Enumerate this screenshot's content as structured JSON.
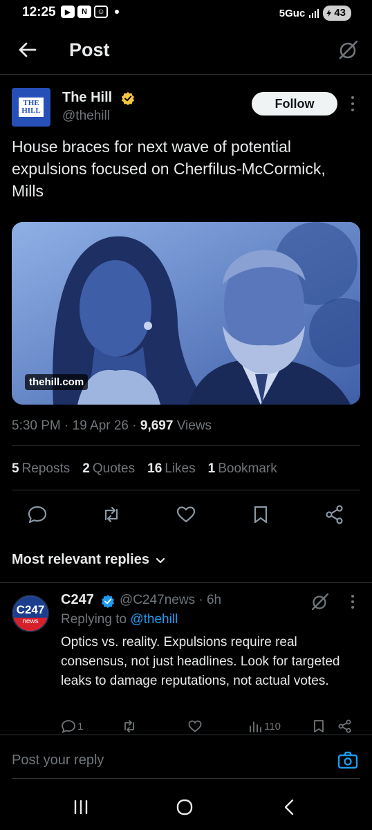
{
  "status_bar": {
    "time": "12:25",
    "network": "5Guc",
    "battery": "43"
  },
  "header": {
    "title": "Post",
    "back_icon": "arrow-left-icon",
    "grok_icon": "grok-icon"
  },
  "tweet": {
    "author_name": "The Hill",
    "author_handle": "@thehill",
    "avatar_text_line1": "THE",
    "avatar_text_line2": "HILL",
    "follow_label": "Follow",
    "text": "House braces for next wave of potential expulsions focused on Cherfilus-McCormick, Mills",
    "media_domain": "thehill.com",
    "time": "5:30 PM",
    "date": "19 Apr 26",
    "views_count": "9,697",
    "views_label": "Views"
  },
  "stats": {
    "reposts_count": "5",
    "reposts_label": "Reposts",
    "quotes_count": "2",
    "quotes_label": "Quotes",
    "likes_count": "16",
    "likes_label": "Likes",
    "bookmarks_count": "1",
    "bookmarks_label": "Bookmark"
  },
  "actions": [
    "reply-icon",
    "repost-icon",
    "like-icon",
    "bookmark-icon",
    "share-icon"
  ],
  "replies": {
    "sort_label": "Most relevant replies"
  },
  "reply": {
    "avatar_top": "C247",
    "avatar_bottom": "news",
    "name": "C247",
    "handle_time": "@C247news · 6h",
    "replying_prefix": "Replying to",
    "replying_handle": "@thehill",
    "text": "Optics vs. reality. Expulsions require real consensus, not just headlines. Look for targeted leaks to damage reputations, not actual votes.",
    "reply_count": "1",
    "views_count": "110"
  },
  "composer": {
    "placeholder": "Post your reply"
  },
  "colors": {
    "accent": "#1d9bf0",
    "muted": "#71767b",
    "text": "#e7e9ea",
    "background": "#000000",
    "verified": "#f4c542"
  }
}
